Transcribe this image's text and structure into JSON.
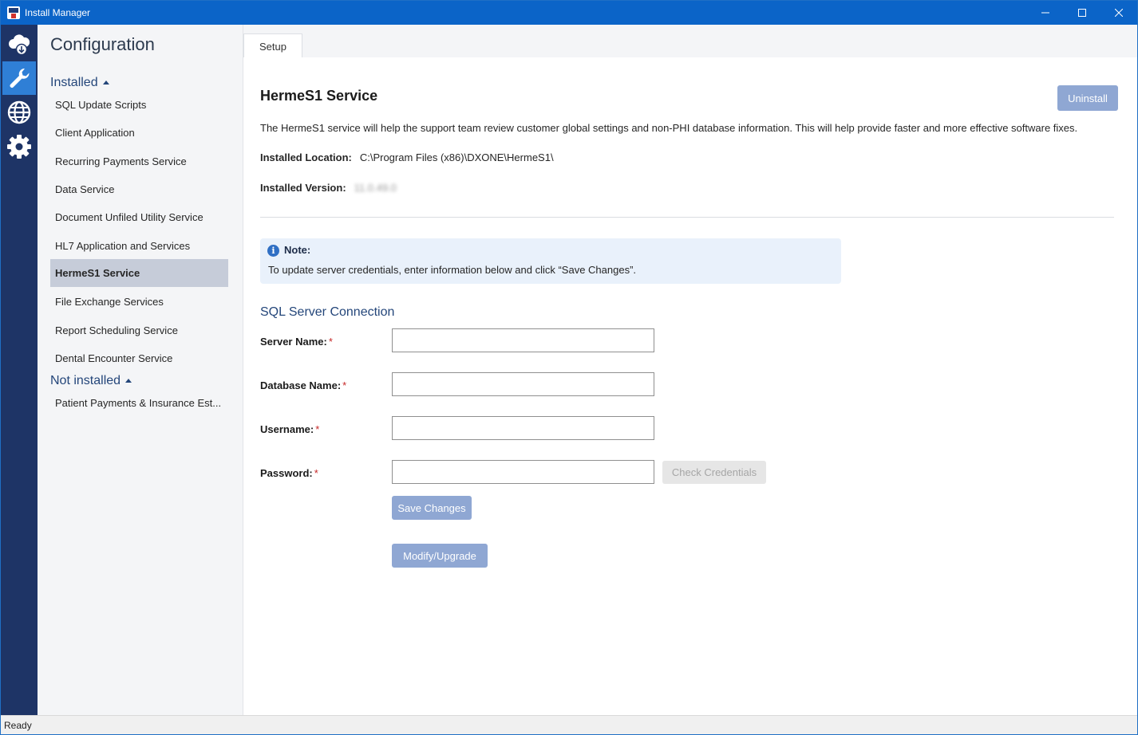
{
  "window": {
    "title": "Install Manager",
    "controls": {
      "minimize": "minimize-icon",
      "maximize": "maximize-icon",
      "close": "close-icon"
    }
  },
  "rail": {
    "items": [
      {
        "icon": "cloud-download-icon",
        "active": false
      },
      {
        "icon": "wrench-icon",
        "active": true
      },
      {
        "icon": "globe-icon",
        "active": false
      },
      {
        "icon": "gear-icon",
        "active": false
      }
    ]
  },
  "sidebar": {
    "title": "Configuration",
    "installed_label": "Installed",
    "installed": [
      "SQL Update Scripts",
      "Client Application",
      "Recurring Payments Service",
      "Data Service",
      "Document Unfiled Utility Service",
      "HL7 Application and Services",
      "HermeS1 Service",
      "File Exchange Services",
      "Report Scheduling Service",
      "Dental Encounter Service"
    ],
    "selected": "HermeS1 Service",
    "not_installed_label": "Not installed",
    "not_installed": [
      "Patient Payments & Insurance Est..."
    ]
  },
  "tabs": [
    {
      "label": "Setup",
      "active": true
    }
  ],
  "main": {
    "heading": "HermeS1 Service",
    "uninstall_label": "Uninstall",
    "description": "The HermeS1 service will help the support team review customer global settings and non-PHI database information. This will help provide faster and more effective software fixes.",
    "location_label": "Installed Location:",
    "location_value": "C:\\Program Files (x86)\\DXONE\\HermeS1\\",
    "version_label": "Installed Version:",
    "version_value": "11.0.49.0",
    "note": {
      "title": "Note:",
      "text": "To update server credentials, enter information below and click “Save Changes”."
    },
    "sql_section_title": "SQL Server Connection",
    "fields": {
      "server_label": "Server Name:",
      "server_value": "",
      "database_label": "Database Name:",
      "database_value": "",
      "username_label": "Username:",
      "username_value": "",
      "password_label": "Password:",
      "password_value": "",
      "required_mark": "*"
    },
    "check_credentials_label": "Check Credentials",
    "save_changes_label": "Save Changes",
    "modify_upgrade_label": "Modify/Upgrade"
  },
  "status": {
    "text": "Ready"
  },
  "colors": {
    "titlebar": "#0b64c8",
    "rail": "#1e3466",
    "rail_active": "#2f7fd6",
    "primary_disabled": "#8fa7d3",
    "required": "#c62828"
  }
}
